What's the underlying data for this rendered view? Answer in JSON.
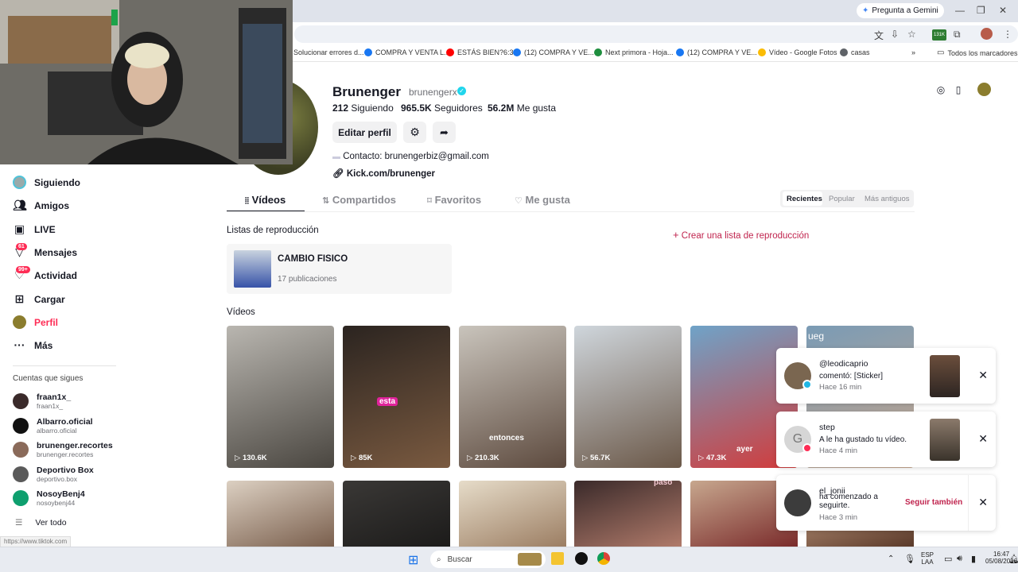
{
  "browser": {
    "gemini_label": "Pregunta a Gemini",
    "ext_badge": "131K",
    "bookmarks": [
      {
        "label": "Solucionar errores d...",
        "color": "#e6e6e6"
      },
      {
        "label": "COMPRA Y VENTA L...",
        "color": "#1877f2"
      },
      {
        "label": "ESTÁS BIEN?6:33",
        "color": "#ff0000"
      },
      {
        "label": "(12) COMPRA Y VE...",
        "color": "#1877f2"
      },
      {
        "label": "Next primora - Hoja...",
        "color": "#1e8e3e"
      },
      {
        "label": "(12) COMPRA Y VE...",
        "color": "#1877f2"
      },
      {
        "label": "Vídeo - Google Fotos",
        "color": "#fbbc04"
      },
      {
        "label": "casas",
        "color": "#5f6368"
      }
    ],
    "all_bookmarks": "Todos los marcadores",
    "status_url": "https://www.tiktok.com"
  },
  "profile": {
    "name": "Brunenger",
    "username": "brunengerx",
    "following": "212",
    "following_label": "Siguiendo",
    "followers": "965.5K",
    "followers_label": "Seguidores",
    "likes": "56.2M",
    "likes_label": "Me gusta",
    "edit_label": "Editar perfil",
    "contact": "Contacto: brunengerbiz@gmail.com",
    "link": "Kick.com/brunenger"
  },
  "tabs": [
    "Vídeos",
    "Compartidos",
    "Favoritos",
    "Me gusta"
  ],
  "sort": [
    "Recientes",
    "Popular",
    "Más antiguos"
  ],
  "playlists": {
    "title": "Listas de reproducción",
    "create": "Crear una lista de reproducción",
    "items": [
      {
        "title": "CAMBIO FISICO",
        "count": "17 publicaciones"
      }
    ]
  },
  "videos_title": "Vídeos",
  "videos_row1": [
    {
      "views": "130.6K",
      "caption": ""
    },
    {
      "views": "85K",
      "caption": "esta"
    },
    {
      "views": "210.3K",
      "caption": "entonces"
    },
    {
      "views": "56.7K",
      "caption": ""
    },
    {
      "views": "47.3K",
      "caption": "ayer"
    },
    {
      "views": "",
      "caption": "ueg"
    }
  ],
  "videos_row2_captions": [
    "",
    "",
    "",
    "paso",
    "",
    ""
  ],
  "sidebar": {
    "items": [
      {
        "label": "Siguiendo",
        "icon": "following-avatar"
      },
      {
        "label": "Amigos",
        "icon": "friends-icon"
      },
      {
        "label": "LIVE",
        "icon": "live-icon"
      },
      {
        "label": "Mensajes",
        "icon": "messages-icon",
        "badge": "61"
      },
      {
        "label": "Actividad",
        "icon": "activity-icon",
        "badge": "99+"
      },
      {
        "label": "Cargar",
        "icon": "upload-icon"
      },
      {
        "label": "Perfil",
        "icon": "profile-avatar"
      },
      {
        "label": "Más",
        "icon": "more-icon"
      }
    ],
    "following_title": "Cuentas que sigues",
    "accounts": [
      {
        "name": "fraan1x_",
        "handle": "fraan1x_",
        "color": "#3a2a2a"
      },
      {
        "name": "Albarro.oficial",
        "handle": "albarro.oficial",
        "color": "#111111"
      },
      {
        "name": "brunenger.recortes",
        "handle": "brunenger.recortes",
        "color": "#8a6a5a"
      },
      {
        "name": "Deportivo Box",
        "handle": "deportivo.box",
        "color": "#5a5a5a"
      },
      {
        "name": "NosoyBenj4",
        "handle": "nosoybenj44",
        "color": "#0e9f6e"
      }
    ],
    "see_all": "Ver todo"
  },
  "notifications": [
    {
      "user": "@leodicaprio",
      "message": "comentó: [Sticker]",
      "time": "Hace 16 min"
    },
    {
      "user": "step",
      "message": "A le ha gustado tu vídeo.",
      "time": "Hace 4 min",
      "initial": "G"
    },
    {
      "user": "el_jonii",
      "message": "ha comenzado a seguirte.",
      "time": "Hace 3 min",
      "action": "Seguir también"
    }
  ],
  "taskbar": {
    "search": "Buscar",
    "lang1": "ESP",
    "lang2": "LAA",
    "time": "16:47",
    "date": "05/08/2026"
  }
}
